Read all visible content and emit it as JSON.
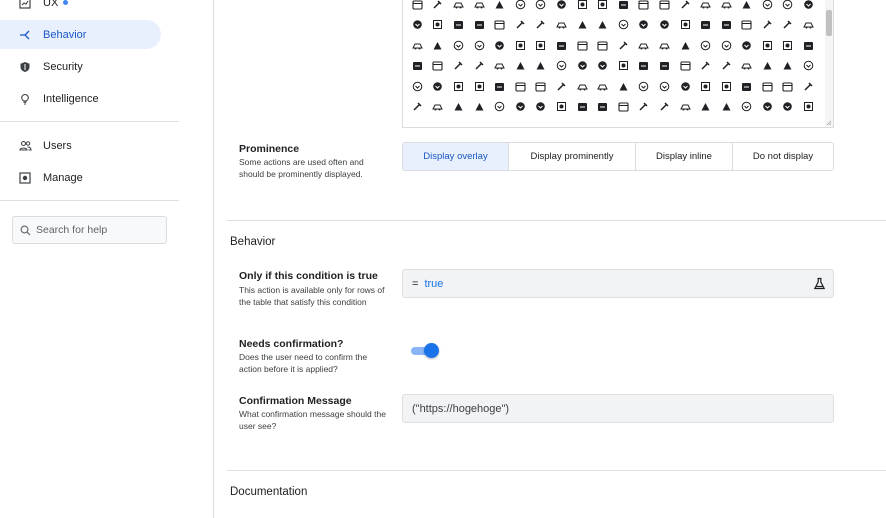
{
  "sidebar": {
    "items": [
      {
        "name": "ux",
        "label": "UX",
        "icon": "chart-icon",
        "active": false
      },
      {
        "name": "behavior",
        "label": "Behavior",
        "icon": "branch-icon",
        "active": true
      },
      {
        "name": "security",
        "label": "Security",
        "icon": "shield-icon",
        "active": false
      },
      {
        "name": "intelligence",
        "label": "Intelligence",
        "icon": "lightbulb-icon",
        "active": false
      },
      {
        "name": "users",
        "label": "Users",
        "icon": "users-icon",
        "active": false
      },
      {
        "name": "manage",
        "label": "Manage",
        "icon": "manage-icon",
        "active": false
      }
    ],
    "search_placeholder": "Search for help"
  },
  "icon_grid": {
    "rows": 6,
    "cols": 20
  },
  "prominence": {
    "label": "Prominence",
    "description": "Some actions are used often and should be prominently displayed.",
    "options": [
      "Display overlay",
      "Display prominently",
      "Display inline",
      "Do not display"
    ],
    "selected": "Display overlay"
  },
  "behavior_section": {
    "title": "Behavior",
    "condition": {
      "label": "Only if this condition is true",
      "description": "This action is available only for rows of the table that satisfy this condition",
      "operator": "=",
      "value": "true"
    },
    "confirmation": {
      "label": "Needs confirmation?",
      "description": "Does the user need to confirm the action before it is applied?",
      "enabled": true
    },
    "confirmation_message": {
      "label": "Confirmation Message",
      "description": "What confirmation message should the user see?",
      "value": "(\"https://hogehoge\")"
    }
  },
  "documentation_section": {
    "title": "Documentation"
  },
  "colors": {
    "accent": "#1a73e8",
    "active_bg": "#e8f0fe",
    "field_bg": "#f1f3f4"
  }
}
